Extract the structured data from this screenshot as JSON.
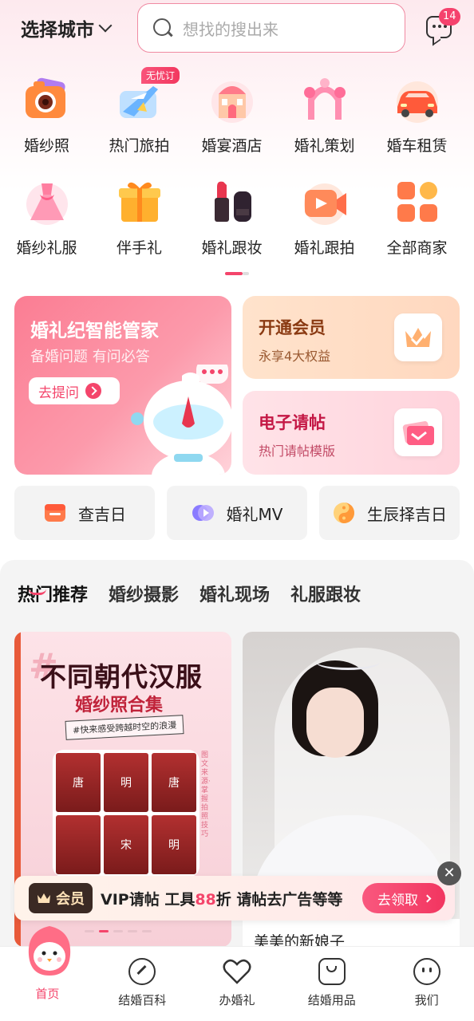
{
  "header": {
    "city_label": "选择城市",
    "search_placeholder": "想找的搜出来",
    "message_badge": "14"
  },
  "categories": [
    {
      "label": "婚纱照",
      "icon": "camera-icon"
    },
    {
      "label": "热门旅拍",
      "icon": "airplane-icon",
      "tag": "无忧订"
    },
    {
      "label": "婚宴酒店",
      "icon": "hotel-icon"
    },
    {
      "label": "婚礼策划",
      "icon": "arch-icon"
    },
    {
      "label": "婚车租赁",
      "icon": "car-icon"
    },
    {
      "label": "婚纱礼服",
      "icon": "dress-icon"
    },
    {
      "label": "伴手礼",
      "icon": "gift-icon"
    },
    {
      "label": "婚礼跟妆",
      "icon": "lipstick-icon"
    },
    {
      "label": "婚礼跟拍",
      "icon": "video-camera-icon"
    },
    {
      "label": "全部商家",
      "icon": "grid-icon"
    }
  ],
  "feature_cards": {
    "ai": {
      "title": "婚礼纪智能管家",
      "subtitle": "备婚问题 有问必答",
      "button": "去提问"
    },
    "vip": {
      "title": "开通会员",
      "subtitle": "永享4大权益"
    },
    "invitation": {
      "title": "电子请帖",
      "subtitle": "热门请帖模版"
    }
  },
  "tools": [
    {
      "label": "查吉日",
      "icon": "calendar-icon"
    },
    {
      "label": "婚礼MV",
      "icon": "play-icon"
    },
    {
      "label": "生辰择吉日",
      "icon": "yin-yang-icon"
    }
  ],
  "feed": {
    "tabs": [
      "热门推荐",
      "婚纱摄影",
      "婚礼现场",
      "礼服跟妆"
    ],
    "left_card": {
      "hash": "#",
      "title": "不同朝代汉服",
      "subtitle": "婚纱照合集",
      "tag": "#快来感受跨越时空的浪漫",
      "grid": [
        "唐",
        "明",
        "唐",
        "",
        "宋",
        "明"
      ],
      "side_text": "图文来源·掌握拍照技巧"
    },
    "right_card": {
      "name": "美美的新娘子"
    }
  },
  "promo": {
    "vip_label": "会员",
    "text_a": "VIP请帖 工具",
    "text_hl": "88",
    "text_b": "折 请帖去广告等等",
    "button": "去领取"
  },
  "bottom_nav": [
    {
      "label": "首页",
      "icon": "home-mascot-icon",
      "active": true
    },
    {
      "label": "结婚百科",
      "icon": "compass-icon"
    },
    {
      "label": "办婚礼",
      "icon": "heart-icon"
    },
    {
      "label": "结婚用品",
      "icon": "bag-icon"
    },
    {
      "label": "我们",
      "icon": "smile-icon"
    }
  ],
  "colors": {
    "accent": "#f4456b",
    "vip_title": "#8a3a12",
    "invitation_title": "#c41845"
  }
}
